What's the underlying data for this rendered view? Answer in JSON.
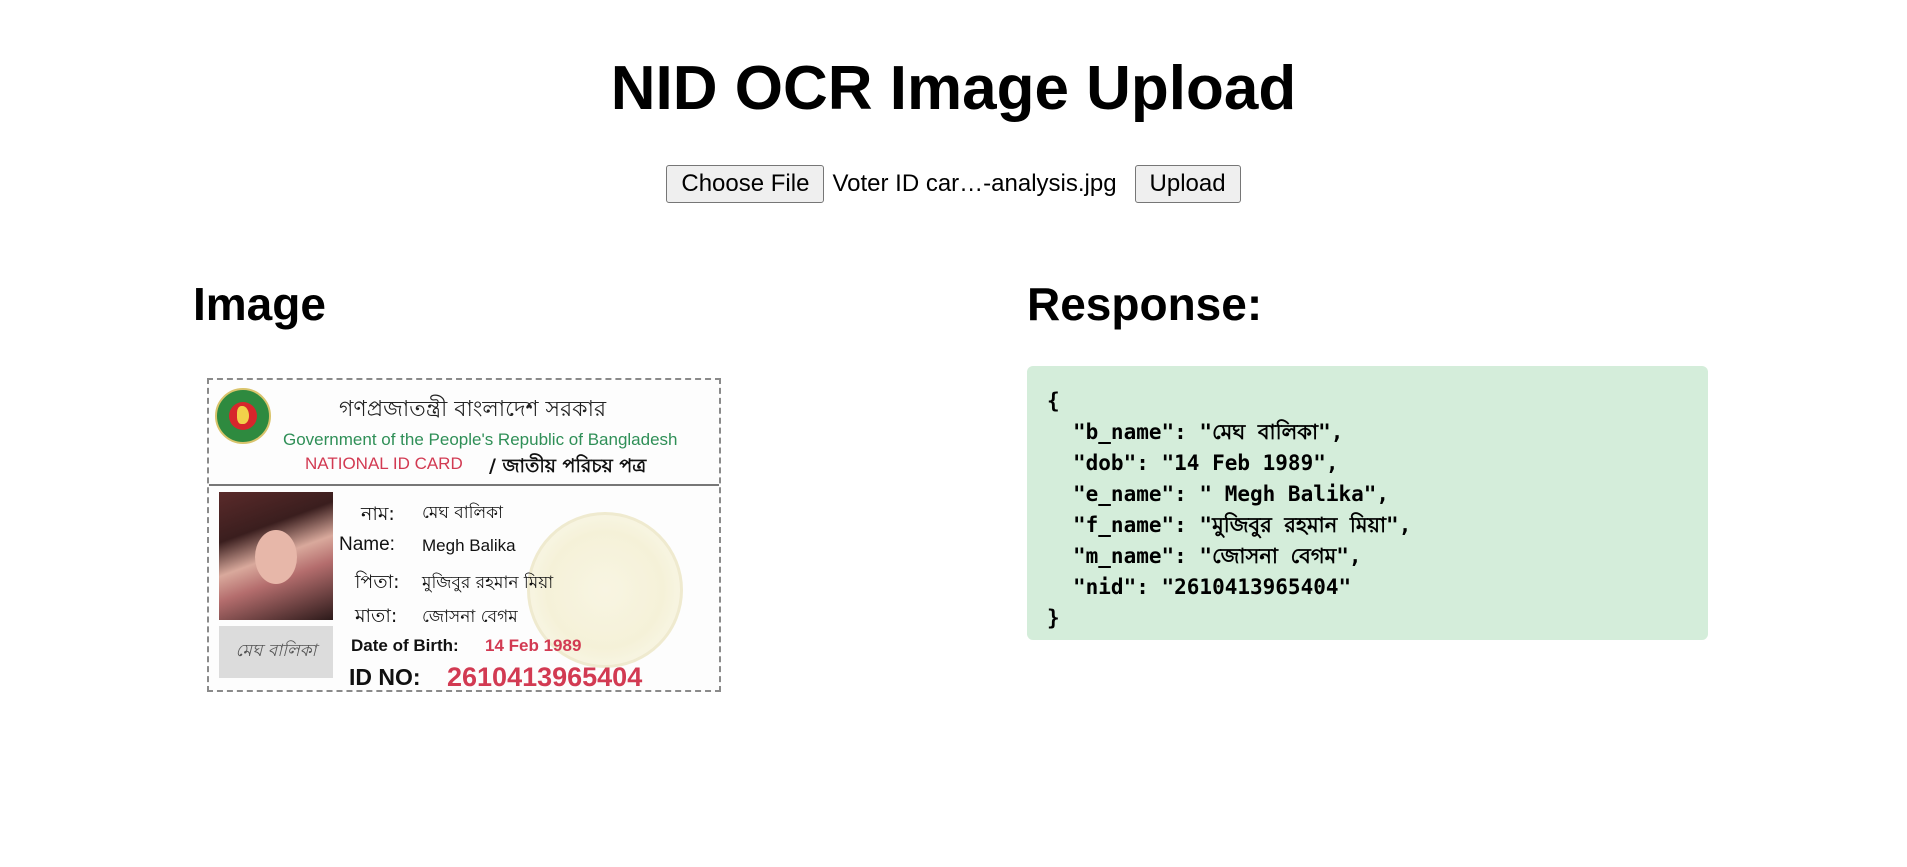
{
  "page": {
    "title": "NID OCR Image Upload"
  },
  "upload": {
    "choose_file_label": "Choose File",
    "file_name": "Voter ID car…-analysis.jpg",
    "upload_label": "Upload"
  },
  "image_section": {
    "heading": "Image",
    "card": {
      "header_bn": "গণপ্রজাতন্ত্রী বাংলাদেশ সরকার",
      "header_en": "Government of the People's Republic of Bangladesh",
      "card_label_en": "NATIONAL ID CARD",
      "card_label_bn": "/ জাতীয় পরিচয় পত্র",
      "name_bn_label": "নাম:",
      "name_bn_value": "মেঘ বালিকা",
      "name_en_label": "Name:",
      "name_en_value": "Megh Balika",
      "father_label": "পিতা:",
      "father_value": "মুজিবুর রহমান মিয়া",
      "mother_label": "মাতা:",
      "mother_value": "জোসনা বেগম",
      "dob_label": "Date of Birth:",
      "dob_value": "14 Feb 1989",
      "id_label": "ID NO:",
      "id_value": "2610413965404",
      "signature": "মেঘ বালিকা"
    }
  },
  "response_section": {
    "heading": "Response:",
    "lines": [
      "{",
      "\"b_name\": \"মেঘ বালিকা\",",
      "\"dob\": \"14 Feb 1989\",",
      "\"e_name\": \" Megh Balika\",",
      "\"f_name\": \"মুজিবুর রহমান মিয়া\",",
      "\"m_name\": \"জোসনা বেগম\",",
      "\"nid\": \"2610413965404\"",
      "}"
    ]
  },
  "colors": {
    "response_bg": "#d4edda",
    "card_red": "#d23a52",
    "card_green": "#2f8f57"
  }
}
